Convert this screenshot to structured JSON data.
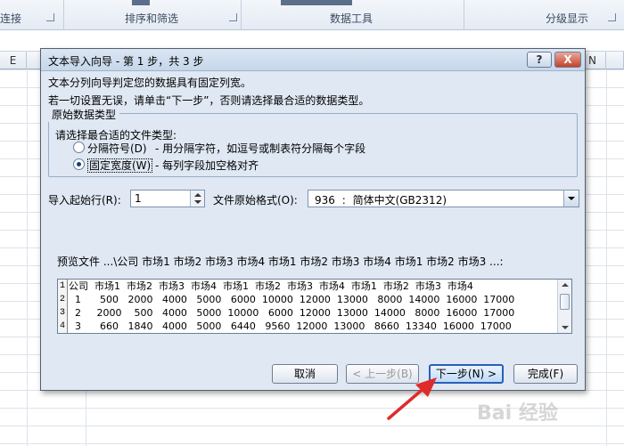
{
  "ribbon": {
    "groups": [
      "连接",
      "排序和筛选",
      "数据工具",
      "分级显示"
    ]
  },
  "sheet": {
    "columns": [
      "E",
      "N"
    ]
  },
  "dialog": {
    "title": "文本导入向导 - 第 1 步，共 3 步",
    "help_label": "?",
    "close_label": "X",
    "line1": "文本分列向导判定您的数据具有固定列宽。",
    "line2": "若一切设置无误，请单击“下一步”，否则请选择最合适的数据类型。",
    "group_title": "原始数据类型",
    "group_prompt": "请选择最合适的文件类型:",
    "options": [
      {
        "label": "分隔符号(D)",
        "desc": "- 用分隔字符，如逗号或制表符分隔每个字段",
        "checked": false
      },
      {
        "label": "固定宽度(W)",
        "desc": "- 每列字段加空格对齐",
        "checked": true
      }
    ],
    "start_row_label": "导入起始行(R):",
    "start_row_value": "1",
    "origin_label": "文件原始格式(O):",
    "origin_value": "936 : 简体中文(GB2312)",
    "preview_label": "预览文件 ...\\公司 市场1 市场2 市场3 市场4 市场1 市场2 市场3 市场4 市场1 市场2 市场3 ...:",
    "preview_rows": [
      {
        "num": "1",
        "text": "公司  市场1  市场2  市场3  市场4  市场1  市场2  市场3  市场4  市场1  市场2  市场3  市场4"
      },
      {
        "num": "2",
        "text": "  1      500   2000   4000   5000   6000  10000  12000  13000   8000  14000  16000  17000"
      },
      {
        "num": "3",
        "text": "  2     2000    500   4000   5000  10000   6000  12000  13000  14000   8000  16000  17000"
      },
      {
        "num": "4",
        "text": "  3      660   1840   4000   5000   6440   9560  12000  13000   8660  13340  16000  17000"
      }
    ],
    "buttons": {
      "cancel": "取消",
      "back": "< 上一步(B)",
      "next": "下一步(N) >",
      "finish": "完成(F)"
    }
  },
  "watermark": "Bai 经验"
}
